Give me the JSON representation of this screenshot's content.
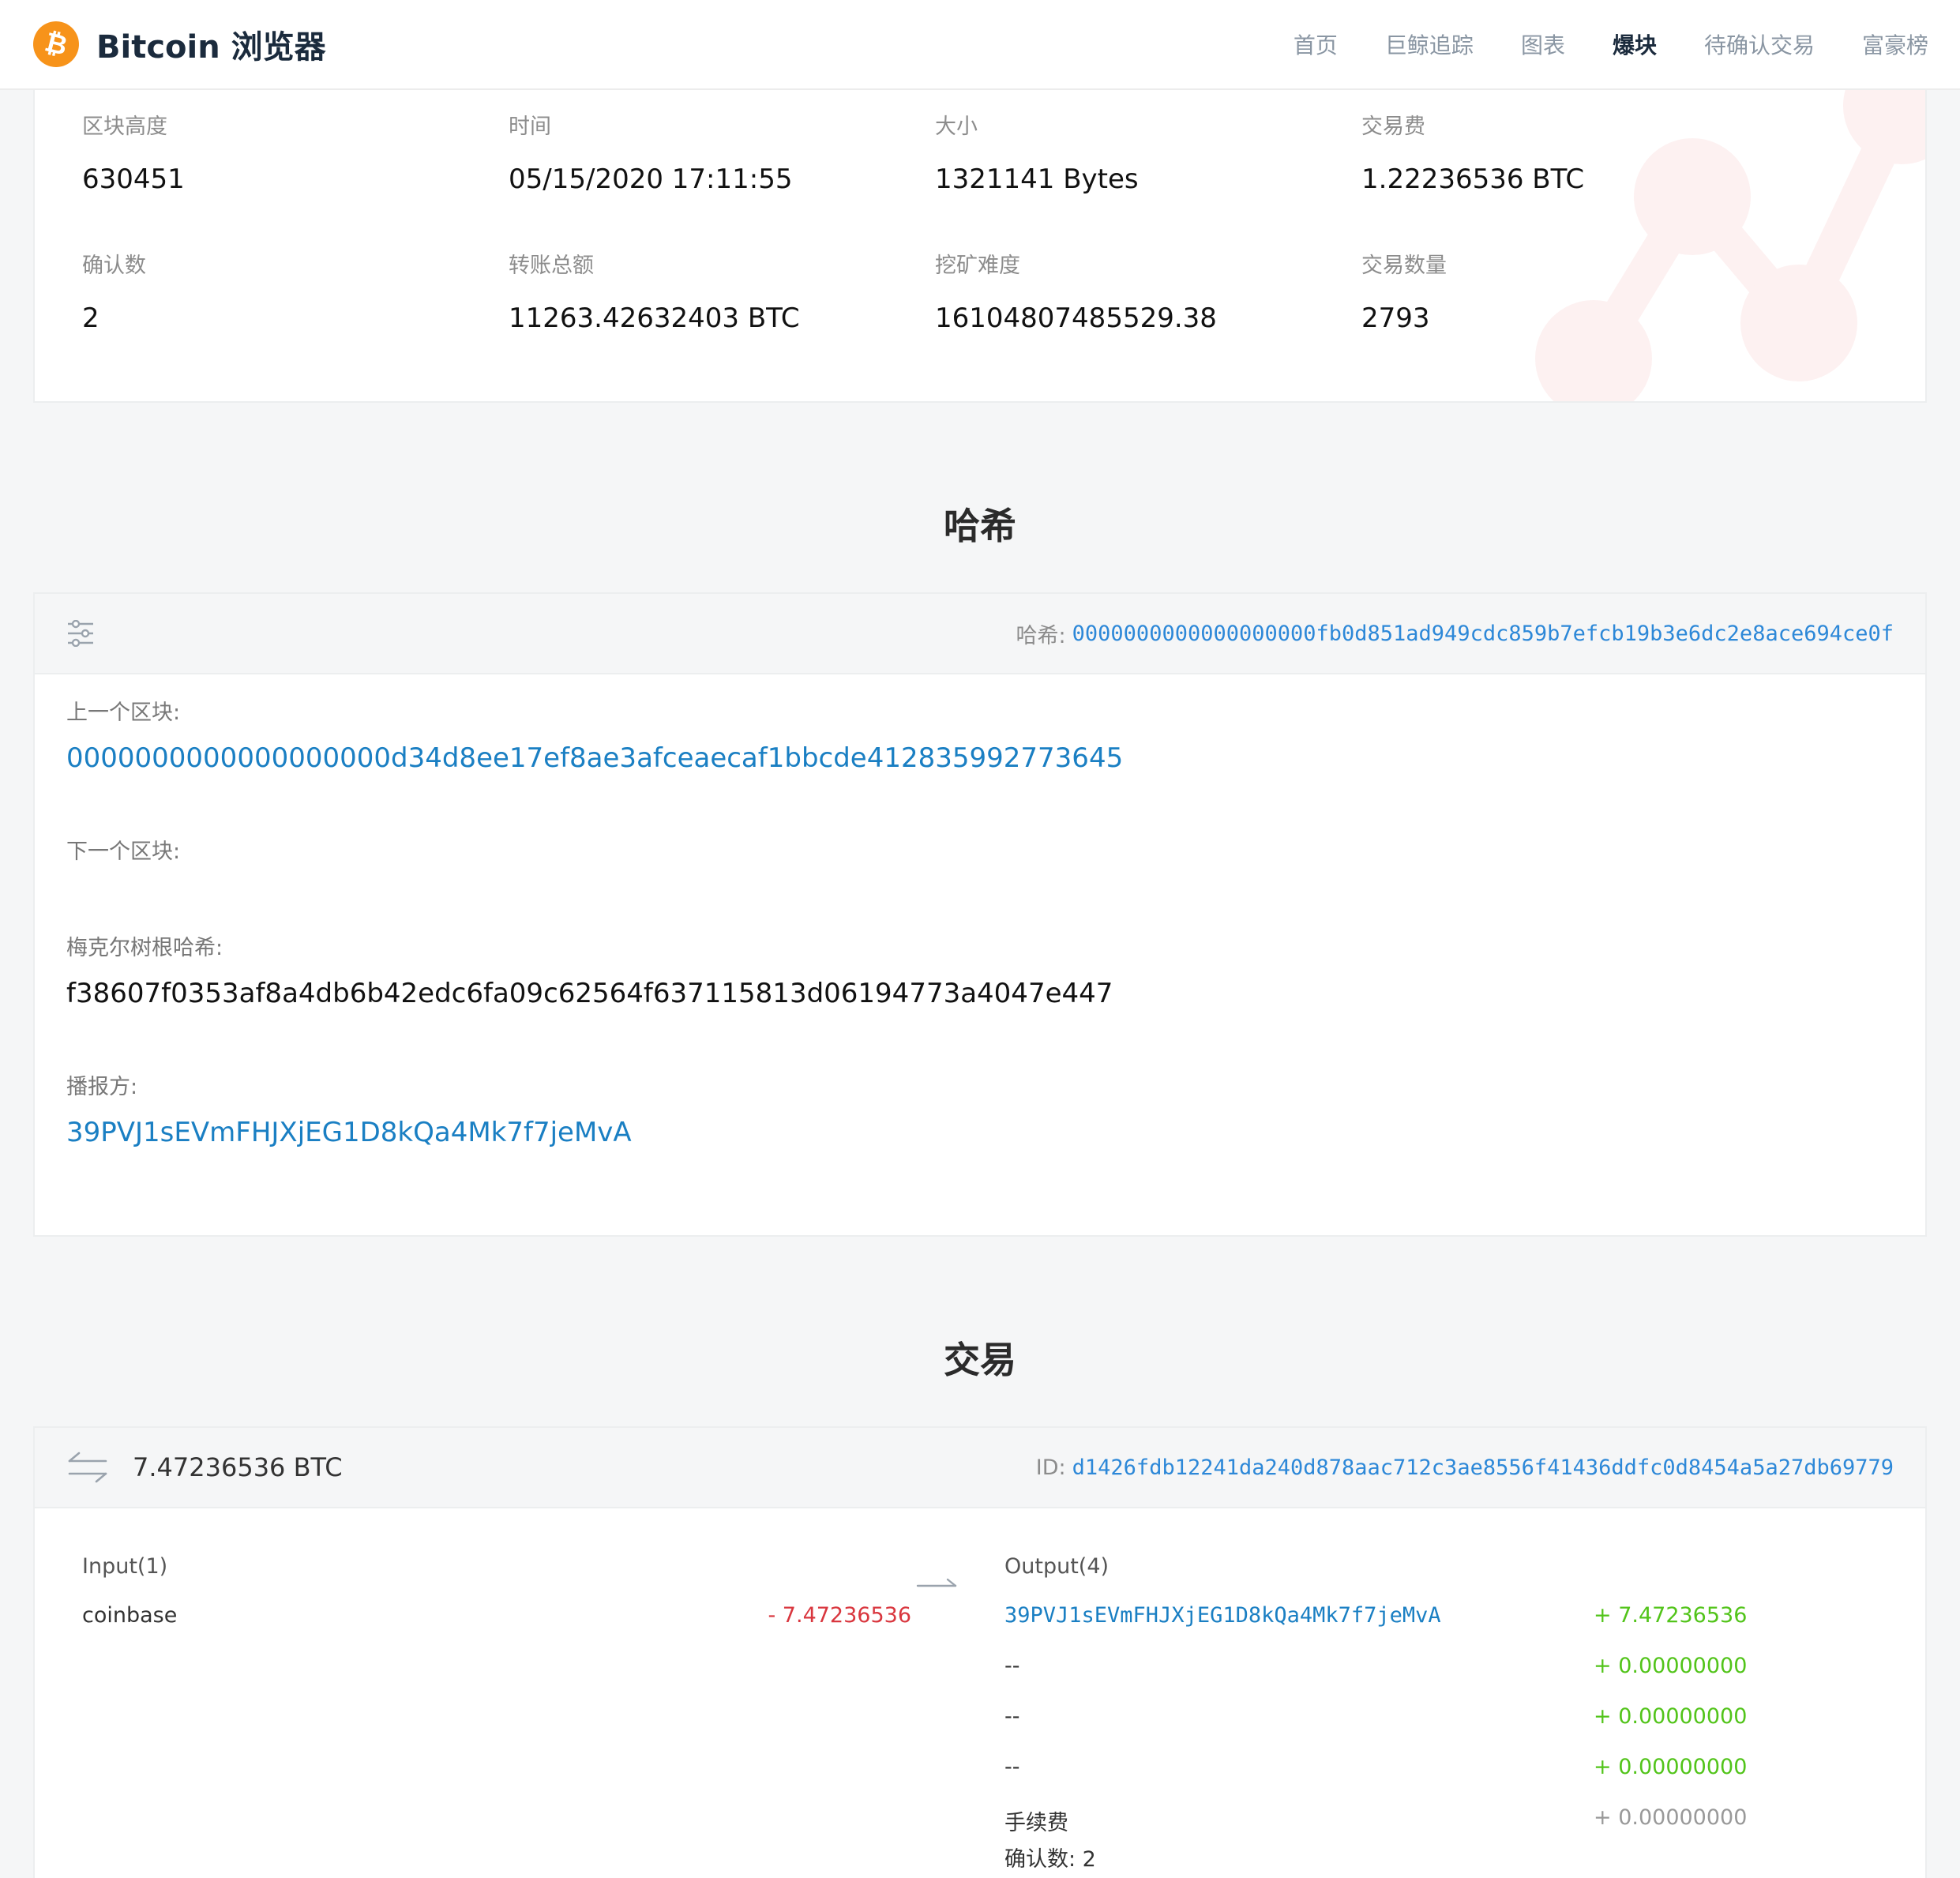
{
  "header": {
    "brand_name": "Bitcoin 浏览器",
    "logo_icon": "bitcoin-icon",
    "nav": [
      {
        "label": "首页",
        "active": false
      },
      {
        "label": "巨鲸追踪",
        "active": false
      },
      {
        "label": "图表",
        "active": false
      },
      {
        "label": "爆块",
        "active": true
      },
      {
        "label": "待确认交易",
        "active": false
      },
      {
        "label": "富豪榜",
        "active": false
      }
    ]
  },
  "summary": {
    "height_label": "区块高度",
    "height": "630451",
    "time_label": "时间",
    "time": "05/15/2020 17:11:55",
    "size_label": "大小",
    "size": "1321141 Bytes",
    "fee_label": "交易费",
    "fee": "1.22236536 BTC",
    "confirmations_label": "确认数",
    "confirmations": "2",
    "total_label": "转账总额",
    "total": "11263.42632403 BTC",
    "difficulty_label": "挖矿难度",
    "difficulty": "16104807485529.38",
    "tx_count_label": "交易数量",
    "tx_count": "2793"
  },
  "hash_section": {
    "title": "哈希",
    "filter_icon": "sliders-icon",
    "hash_label": "哈希:",
    "hash": "0000000000000000000fb0d851ad949cdc859b7efcb19b3e6dc2e8ace694ce0f",
    "prev_label": "上一个区块:",
    "prev_hash": "0000000000000000000d34d8ee17ef8ae3afceaecaf1bbcde412835992773645",
    "next_label": "下一个区块:",
    "next_hash": "",
    "merkle_label": "梅克尔树根哈希:",
    "merkle_root": "f38607f0353af8a4db6b42edc6fa09c62564f637115813d06194773a4047e447",
    "relayed_label": "播报方:",
    "relayed_by": "39PVJ1sEVmFHJXjEG1D8kQa4Mk7f7jeMvA"
  },
  "tx_section": {
    "title": "交易",
    "transfer_icon": "transfer-arrows-icon",
    "amount": "7.47236536 BTC",
    "id_label": "ID:",
    "id": "d1426fdb12241da240d878aac712c3ae8556f41436ddfc0d8454a5a27db69779",
    "input_label": "Input(1)",
    "inputs": [
      {
        "address": "coinbase",
        "amount": "- 7.47236536"
      }
    ],
    "arrow_icon": "arrow-right-icon",
    "output_label": "Output(4)",
    "outputs": [
      {
        "address": "39PVJ1sEVmFHJXjEG1D8kQa4Mk7f7jeMvA",
        "amount": "+ 7.47236536"
      },
      {
        "address": "--",
        "amount": "+ 0.00000000"
      },
      {
        "address": "--",
        "amount": "+ 0.00000000"
      },
      {
        "address": "--",
        "amount": "+ 0.00000000"
      }
    ],
    "fee_label": "手续费",
    "fee_amount": "+ 0.00000000",
    "confirmations_text": "确认数: 2"
  },
  "colors": {
    "accent": "#1a7fc3",
    "brand": "#f7931a",
    "negative": "#d9363e",
    "positive": "#52c41a"
  }
}
